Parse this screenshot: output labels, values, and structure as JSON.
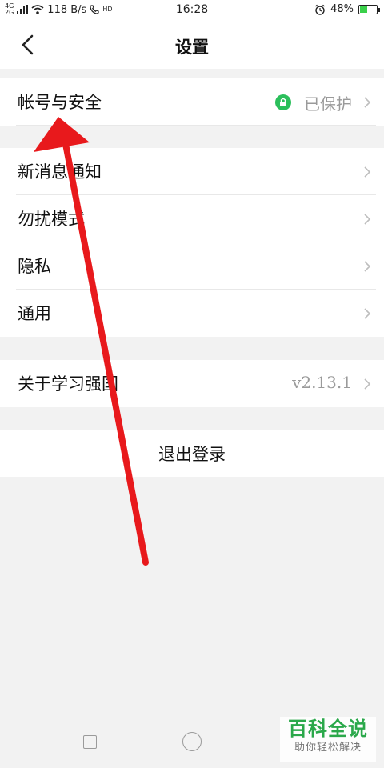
{
  "status_bar": {
    "signal_1": "4G",
    "signal_2": "2G",
    "network_speed": "118 B/s",
    "call_indicator": "HD",
    "time": "16:28",
    "battery_percent": "48%",
    "battery_level": 0.48,
    "battery_color": "#3ad04a"
  },
  "nav": {
    "title": "设置",
    "back_icon": "chevron-left-icon"
  },
  "sections": {
    "account": {
      "label": "帐号与安全",
      "status": "已保护",
      "status_icon": "lock-icon",
      "status_color": "#2bbf5b"
    },
    "settings_items": [
      {
        "label": "新消息通知"
      },
      {
        "label": "勿扰模式"
      },
      {
        "label": "隐私"
      },
      {
        "label": "通用"
      }
    ],
    "about": {
      "label": "关于学习强国",
      "version": "v2.13.1"
    },
    "logout_label": "退出登录"
  },
  "system_nav": {
    "recent_icon": "square-icon",
    "home_icon": "circle-icon"
  },
  "watermark": {
    "title": "百科全说",
    "subtitle": "助你轻松解决"
  },
  "annotation": {
    "arrow_color": "#e8191c"
  }
}
